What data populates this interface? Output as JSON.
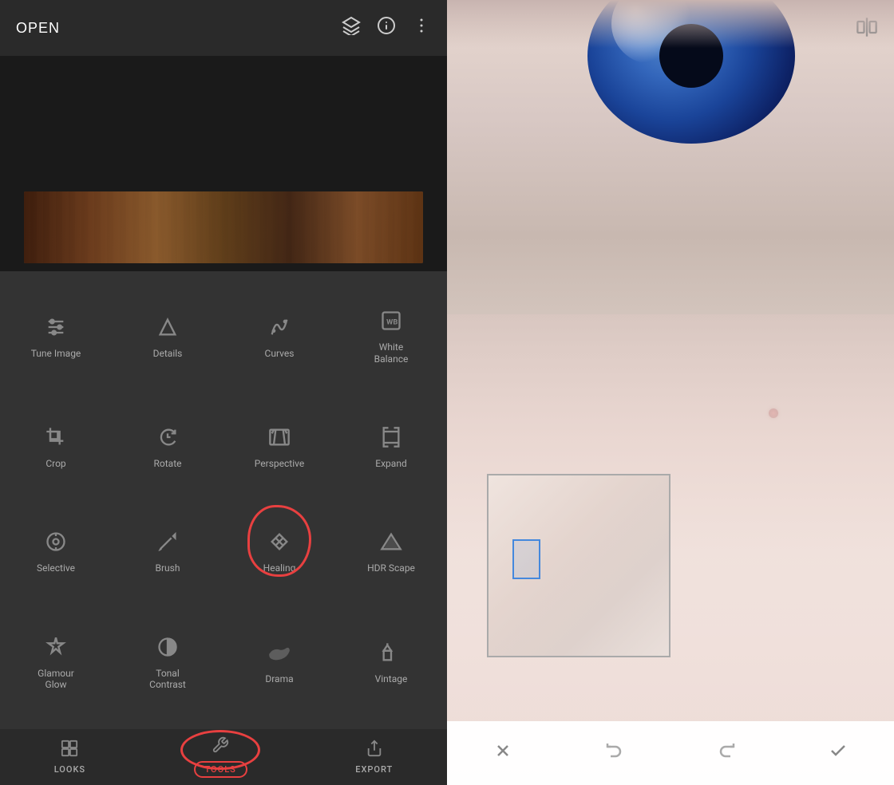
{
  "app": {
    "title": "OPEN"
  },
  "topbar": {
    "open_label": "OPEN"
  },
  "tools": [
    {
      "id": "tune-image",
      "label": "Tune Image",
      "icon": "tune"
    },
    {
      "id": "details",
      "label": "Details",
      "icon": "details"
    },
    {
      "id": "curves",
      "label": "Curves",
      "icon": "curves"
    },
    {
      "id": "white-balance",
      "label": "White\nBalance",
      "icon": "wb"
    },
    {
      "id": "crop",
      "label": "Crop",
      "icon": "crop"
    },
    {
      "id": "rotate",
      "label": "Rotate",
      "icon": "rotate"
    },
    {
      "id": "perspective",
      "label": "Perspective",
      "icon": "perspective"
    },
    {
      "id": "expand",
      "label": "Expand",
      "icon": "expand"
    },
    {
      "id": "selective",
      "label": "Selective",
      "icon": "selective"
    },
    {
      "id": "brush",
      "label": "Brush",
      "icon": "brush"
    },
    {
      "id": "healing",
      "label": "Healing",
      "icon": "healing",
      "annotated": true
    },
    {
      "id": "hdr-scape",
      "label": "HDR Scape",
      "icon": "hdr"
    },
    {
      "id": "glamour-glow",
      "label": "Glamour\nGlow",
      "icon": "glamour"
    },
    {
      "id": "tonal-contrast",
      "label": "Tonal\nContrast",
      "icon": "tonal"
    },
    {
      "id": "drama",
      "label": "Drama",
      "icon": "drama"
    },
    {
      "id": "vintage",
      "label": "Vintage",
      "icon": "vintage"
    }
  ],
  "bottom_nav": [
    {
      "id": "looks",
      "label": "LOOKS",
      "active": false
    },
    {
      "id": "tools",
      "label": "TOOLS",
      "active": true
    },
    {
      "id": "export",
      "label": "EXPORT",
      "active": false
    }
  ],
  "action_bar": {
    "cancel_label": "✕",
    "undo_label": "↩",
    "redo_label": "↪",
    "confirm_label": "✓"
  }
}
